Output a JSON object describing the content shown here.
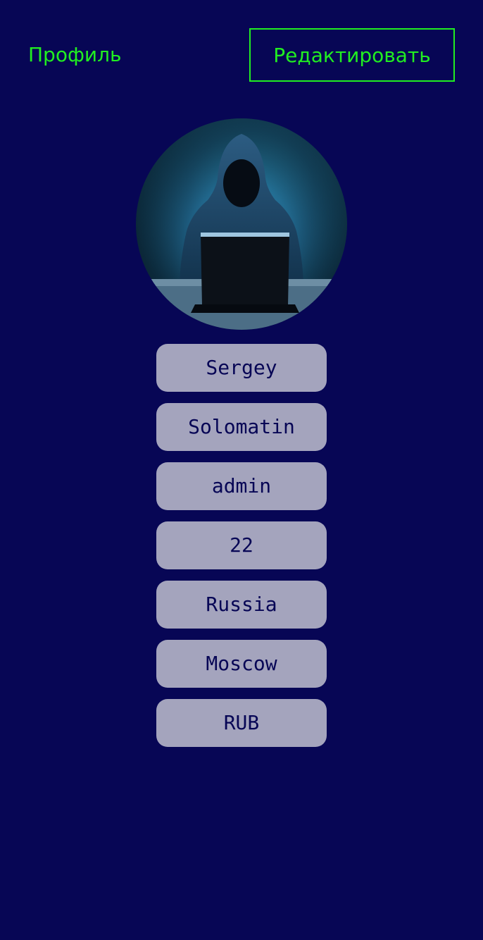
{
  "header": {
    "title": "Профиль",
    "edit_label": "Редактировать"
  },
  "avatar": {
    "icon": "hooded-hacker-laptop-avatar"
  },
  "profile_fields": [
    "Sergey",
    "Solomatin",
    "admin",
    "22",
    "Russia",
    "Moscow",
    "RUB"
  ],
  "colors": {
    "background": "#070655",
    "accent": "#21ee21",
    "field_background": "#a4a4bd",
    "field_text": "#070655"
  }
}
